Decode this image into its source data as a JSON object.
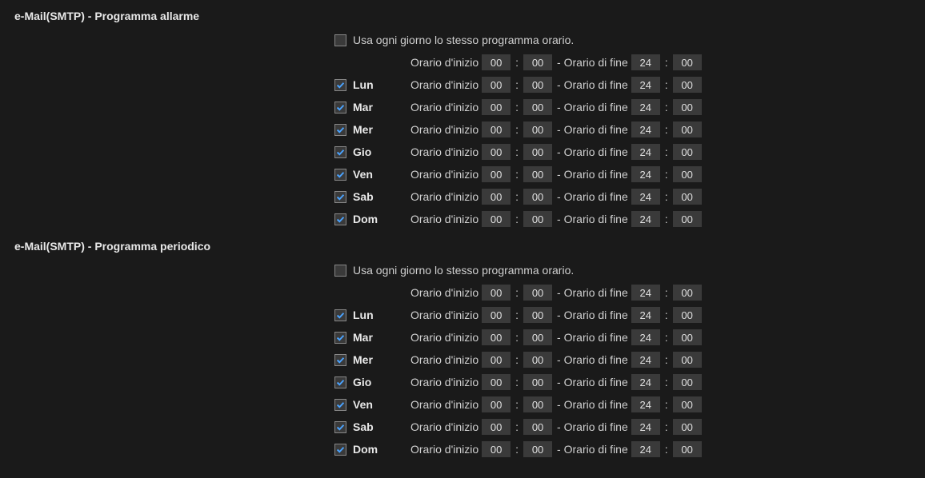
{
  "labels": {
    "start": "Orario d'inizio",
    "end": "Orario di fine",
    "sameEachDay": "Usa ogni giorno lo stesso programma orario."
  },
  "sections": [
    {
      "id": "alarm",
      "title": "e-Mail(SMTP) - Programma allarme",
      "sameEachDay": {
        "checked": false
      },
      "defaultRow": {
        "startH": "00",
        "startM": "00",
        "endH": "24",
        "endM": "00"
      },
      "days": [
        {
          "name": "Lun",
          "checked": true,
          "startH": "00",
          "startM": "00",
          "endH": "24",
          "endM": "00"
        },
        {
          "name": "Mar",
          "checked": true,
          "startH": "00",
          "startM": "00",
          "endH": "24",
          "endM": "00"
        },
        {
          "name": "Mer",
          "checked": true,
          "startH": "00",
          "startM": "00",
          "endH": "24",
          "endM": "00"
        },
        {
          "name": "Gio",
          "checked": true,
          "startH": "00",
          "startM": "00",
          "endH": "24",
          "endM": "00"
        },
        {
          "name": "Ven",
          "checked": true,
          "startH": "00",
          "startM": "00",
          "endH": "24",
          "endM": "00"
        },
        {
          "name": "Sab",
          "checked": true,
          "startH": "00",
          "startM": "00",
          "endH": "24",
          "endM": "00"
        },
        {
          "name": "Dom",
          "checked": true,
          "startH": "00",
          "startM": "00",
          "endH": "24",
          "endM": "00"
        }
      ]
    },
    {
      "id": "periodic",
      "title": "e-Mail(SMTP) - Programma periodico",
      "sameEachDay": {
        "checked": false
      },
      "defaultRow": {
        "startH": "00",
        "startM": "00",
        "endH": "24",
        "endM": "00"
      },
      "days": [
        {
          "name": "Lun",
          "checked": true,
          "startH": "00",
          "startM": "00",
          "endH": "24",
          "endM": "00"
        },
        {
          "name": "Mar",
          "checked": true,
          "startH": "00",
          "startM": "00",
          "endH": "24",
          "endM": "00"
        },
        {
          "name": "Mer",
          "checked": true,
          "startH": "00",
          "startM": "00",
          "endH": "24",
          "endM": "00"
        },
        {
          "name": "Gio",
          "checked": true,
          "startH": "00",
          "startM": "00",
          "endH": "24",
          "endM": "00"
        },
        {
          "name": "Ven",
          "checked": true,
          "startH": "00",
          "startM": "00",
          "endH": "24",
          "endM": "00"
        },
        {
          "name": "Sab",
          "checked": true,
          "startH": "00",
          "startM": "00",
          "endH": "24",
          "endM": "00"
        },
        {
          "name": "Dom",
          "checked": true,
          "startH": "00",
          "startM": "00",
          "endH": "24",
          "endM": "00"
        }
      ]
    }
  ]
}
